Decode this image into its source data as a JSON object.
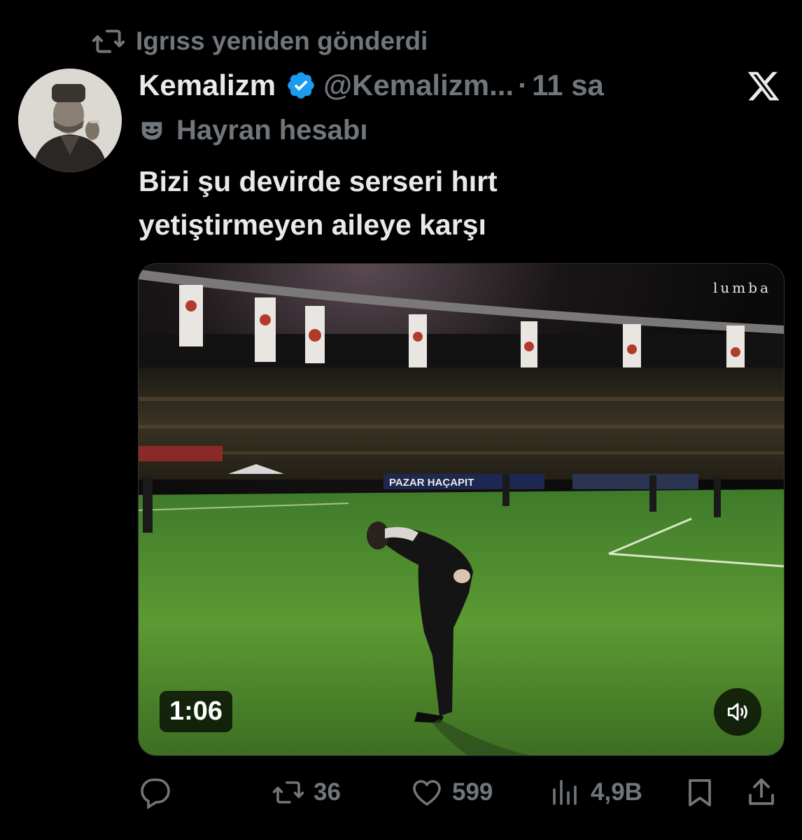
{
  "repost": {
    "text": "Igrıss yeniden gönderdi",
    "icon": "repost-icon"
  },
  "author": {
    "display_name": "Kemalizm",
    "handle": "@Kemalizm...",
    "separator": "·",
    "time": "11 sa",
    "badge_icon": "verified-badge-icon",
    "label": "Hayran hesabı",
    "label_icon": "theater-masks-icon"
  },
  "tweet": {
    "line1": "Bizi şu devirde serseri hırt",
    "line2": "yetiştirmeyen aileye karşı"
  },
  "media": {
    "watermark": "lumba",
    "duration": "1:06",
    "banner_text": "PAZAR HAÇAPIT",
    "volume_icon": "volume-icon"
  },
  "actions": {
    "reply_icon": "reply-icon",
    "repost_count": "36",
    "like_count": "599",
    "views_count": "4,9B",
    "bookmark_icon": "bookmark-icon",
    "share_icon": "share-icon"
  },
  "colors": {
    "background": "#000000",
    "text_primary": "#e7e9ea",
    "text_secondary": "#71767b",
    "verified": "#1d9bf0"
  }
}
